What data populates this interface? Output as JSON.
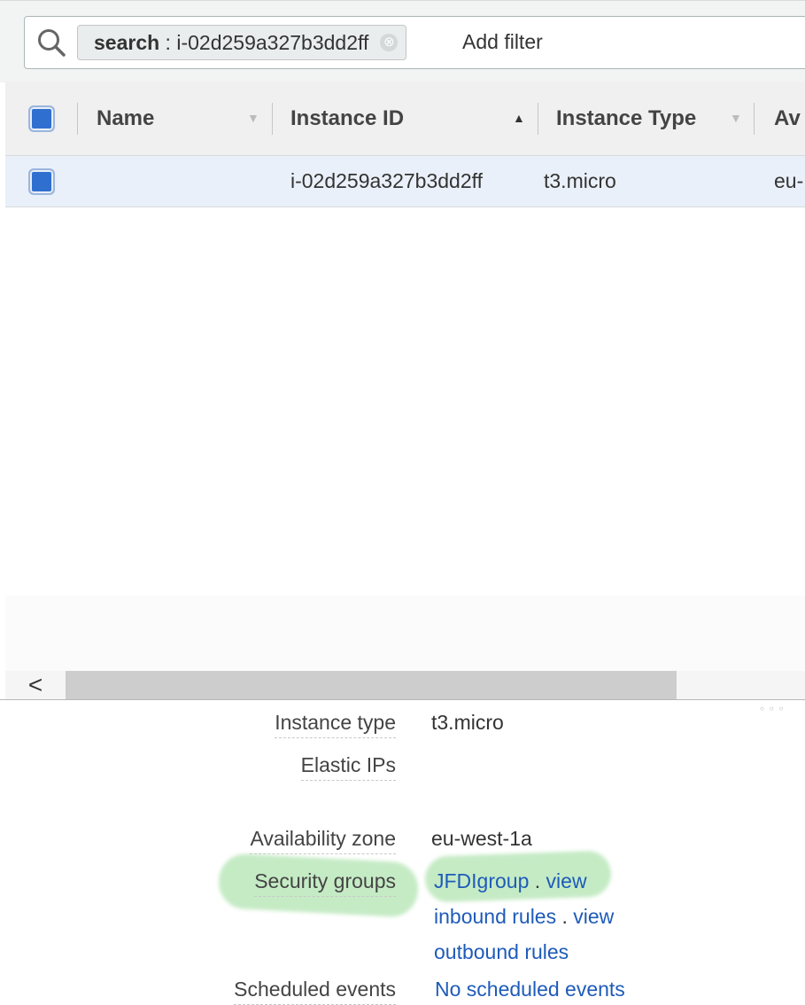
{
  "search": {
    "token_key": "search",
    "token_value": "i-02d259a327b3dd2ff",
    "token_close": "⊗",
    "add_filter": "Add filter"
  },
  "table": {
    "columns": [
      {
        "label": "Name",
        "sort": "▼"
      },
      {
        "label": "Instance ID",
        "sort": "▲"
      },
      {
        "label": "Instance Type",
        "sort": "▼"
      },
      {
        "label": "Av"
      }
    ],
    "rows": [
      {
        "name": "",
        "instance_id": "i-02d259a327b3dd2ff",
        "instance_type": "t3.micro",
        "availability": "eu-"
      }
    ]
  },
  "scrollbar": {
    "left_arrow": "<"
  },
  "details": {
    "instance_type_label": "Instance type",
    "instance_type_value": "t3.micro",
    "elastic_ips_label": "Elastic IPs",
    "elastic_ips_value": "",
    "availability_zone_label": "Availability zone",
    "availability_zone_value": "eu-west-1a",
    "security_groups_label": "Security groups",
    "security_group_name": "JFDIgroup",
    "sep1": " . ",
    "view_inbound": "view inbound rules",
    "sep2": " . ",
    "view_outbound": "view outbound rules",
    "scheduled_events_label": "Scheduled events",
    "scheduled_events_value": "No scheduled events"
  },
  "colors": {
    "accent": "#2f6fd0",
    "link": "#1e5bb8",
    "highlight": "#8cd78c"
  }
}
